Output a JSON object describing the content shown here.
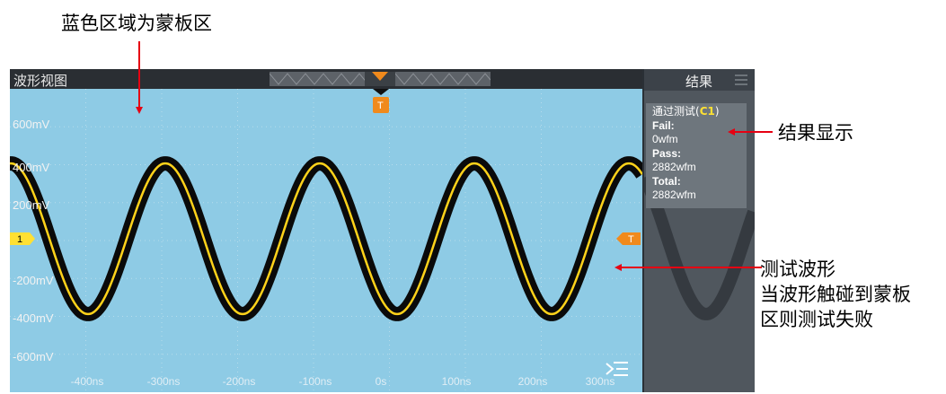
{
  "annotations": {
    "mask_region": "蓝色区域为蒙板区",
    "result_display": "结果显示",
    "test_waveform": [
      "测试波形",
      "当波形触碰到蒙板",
      "区则测试失败"
    ]
  },
  "view": {
    "title": "波形视图"
  },
  "trigger": {
    "marker": "T"
  },
  "channel": {
    "label": "1",
    "color": "#ffd21a"
  },
  "y_axis": {
    "ticks": [
      "600mV",
      "400mV",
      "200mV",
      "-200mV",
      "-400mV",
      "-600mV"
    ]
  },
  "x_axis": {
    "ticks": [
      "-400ns",
      "-300ns",
      "-200ns",
      "-100ns",
      "0s",
      "100ns",
      "200ns",
      "300ns"
    ]
  },
  "panel": {
    "title": "结果",
    "result_header": "通过测试(",
    "result_channel": "C1",
    "result_header_end": ")",
    "fail_label": "Fail:",
    "fail_value": "0wfm",
    "pass_label": "Pass:",
    "pass_value": "2882wfm",
    "total_label": "Total:",
    "total_value": "2882wfm"
  },
  "colors": {
    "mask": "#8ecbe5",
    "waveform": "#ffd21a",
    "annotation_arrow": "#e60012",
    "trigger": "#f08a1c"
  }
}
